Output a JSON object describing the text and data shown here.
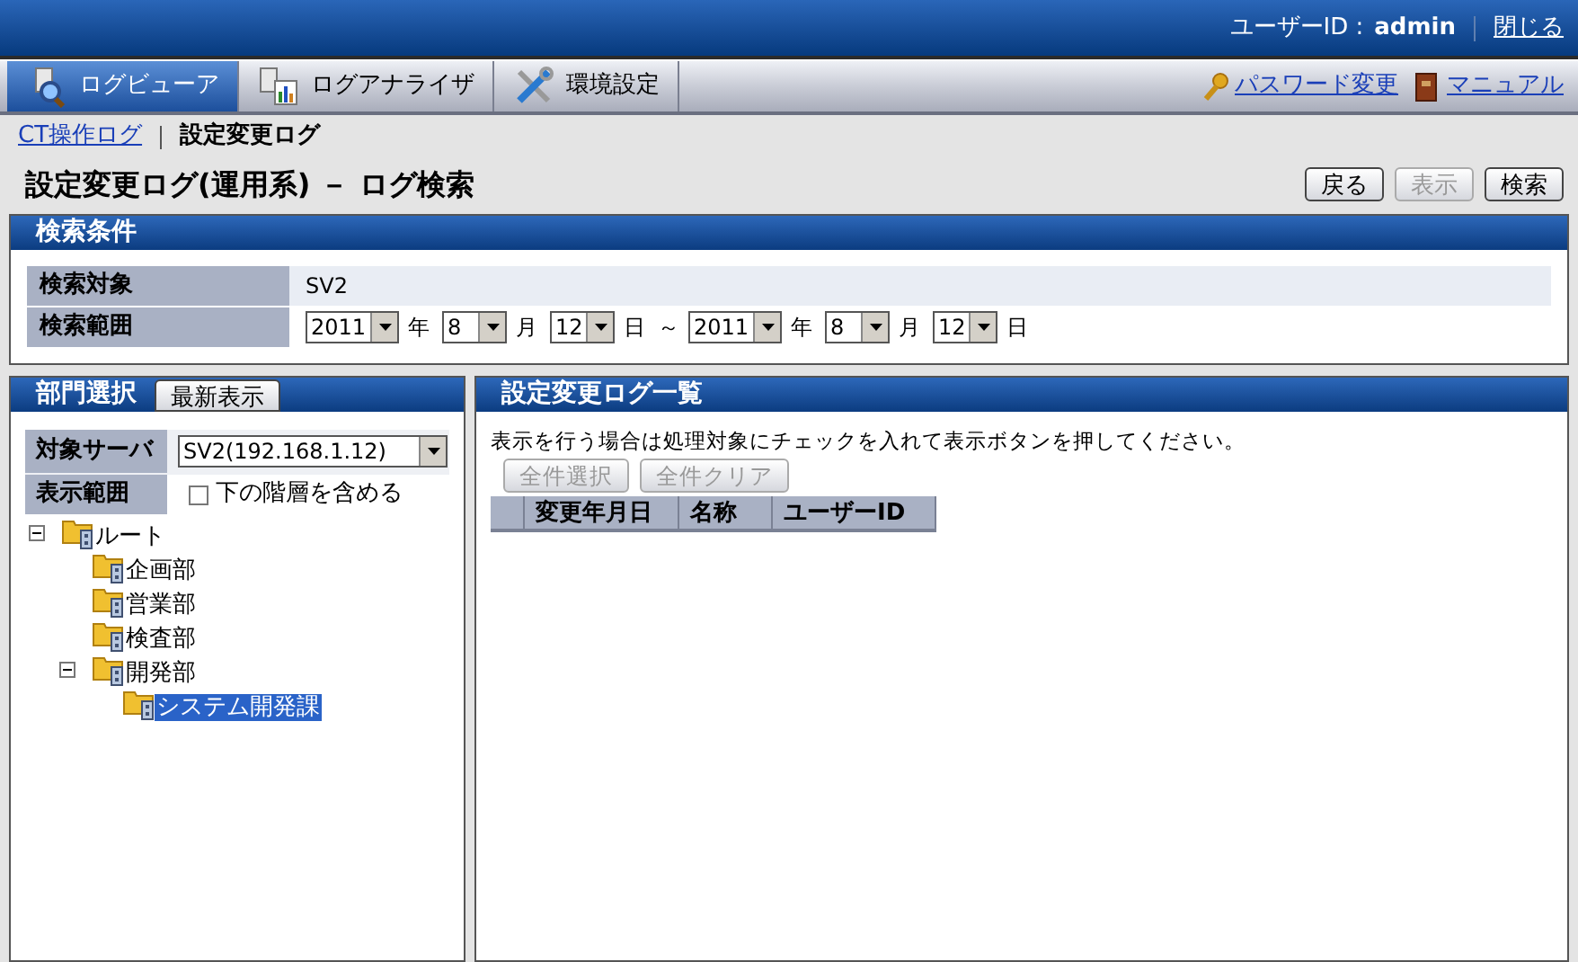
{
  "header": {
    "user_id_label": "ユーザーID :",
    "user_id": "admin",
    "close_link": "閉じる"
  },
  "tabs": [
    {
      "label": "ログビューア",
      "selected": true,
      "kind": "viewer"
    },
    {
      "label": "ログアナライザ",
      "selected": false,
      "kind": "analyzer"
    },
    {
      "label": "環境設定",
      "selected": false,
      "kind": "settings"
    }
  ],
  "tab_links": [
    {
      "label": "パスワード変更",
      "kind": "key"
    },
    {
      "label": "マニュアル",
      "kind": "book"
    }
  ],
  "breadcrumb": [
    {
      "label": "CT操作ログ",
      "kind": "link"
    },
    {
      "label": "設定変更ログ",
      "kind": "current"
    }
  ],
  "page_title": "設定変更ログ(運用系) － ログ検索",
  "actions": [
    {
      "label": "戻る",
      "disabled": false
    },
    {
      "label": "表示",
      "disabled": true
    },
    {
      "label": "検索",
      "disabled": false
    }
  ],
  "search_conditions": {
    "title": "検索条件",
    "target_label": "検索対象",
    "target_value": "SV2",
    "range_label": "検索範囲",
    "range": [
      {
        "value": "2011",
        "unit": "年"
      },
      {
        "value": "8",
        "unit": "月"
      },
      {
        "value": "12",
        "unit": "日"
      },
      {
        "value": "2011",
        "unit": "年"
      },
      {
        "value": "8",
        "unit": "月"
      },
      {
        "value": "12",
        "unit": "日"
      }
    ],
    "separator": "～"
  },
  "department_panel": {
    "title": "部門選択",
    "refresh_button": "最新表示",
    "server_label": "対象サーバ",
    "server_value": "SV2(192.168.1.12)",
    "scope_label": "表示範囲",
    "scope_checkbox": {
      "label": "下の階層を含める",
      "checked": false
    },
    "tree": [
      {
        "label": "ルート",
        "expanded": true,
        "selected": false,
        "children": [
          {
            "label": "企画部",
            "selected": false
          },
          {
            "label": "営業部",
            "selected": false
          },
          {
            "label": "検査部",
            "selected": false
          },
          {
            "label": "開発部",
            "expanded": true,
            "selected": false,
            "children": [
              {
                "label": "システム開発課",
                "selected": true
              }
            ]
          }
        ]
      }
    ]
  },
  "log_list": {
    "title": "設定変更ログ一覧",
    "instruction": "表示を行う場合は処理対象にチェックを入れて表示ボタンを押してください。",
    "buttons": [
      {
        "label": "全件選択",
        "disabled": true
      },
      {
        "label": "全件クリア",
        "disabled": true
      }
    ],
    "columns": [
      "変更年月日",
      "名称",
      "ユーザーID"
    ]
  }
}
